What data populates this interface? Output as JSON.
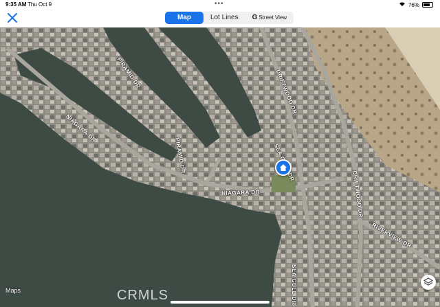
{
  "status_bar": {
    "time": "9:35 AM",
    "date": "Thu Oct 9",
    "battery": "76%"
  },
  "toolbar": {
    "tabs": [
      {
        "label": "Map",
        "active": true
      },
      {
        "label": "Lot Lines",
        "active": false
      },
      {
        "label": "Street View",
        "active": false,
        "icon": "google-g-icon"
      }
    ]
  },
  "map": {
    "streets": [
      {
        "label": "NIAGARA DR"
      },
      {
        "label": "PIRAMID DR"
      },
      {
        "label": "PIRAMID DR"
      },
      {
        "label": "NIAGARA DR"
      },
      {
        "label": "DRIFTWOOD DR"
      },
      {
        "label": "DRIFTWOOD DR"
      },
      {
        "label": "SEA GULL DR"
      },
      {
        "label": "SEA GULL DR"
      },
      {
        "label": "RIVERVIEW DR"
      }
    ],
    "attribution": "Maps",
    "watermark": "CRMLS"
  },
  "colors": {
    "accent": "#1a73e8",
    "water": "#3d4b45",
    "land": "#8a8a82",
    "desert": "#c8b89c"
  }
}
